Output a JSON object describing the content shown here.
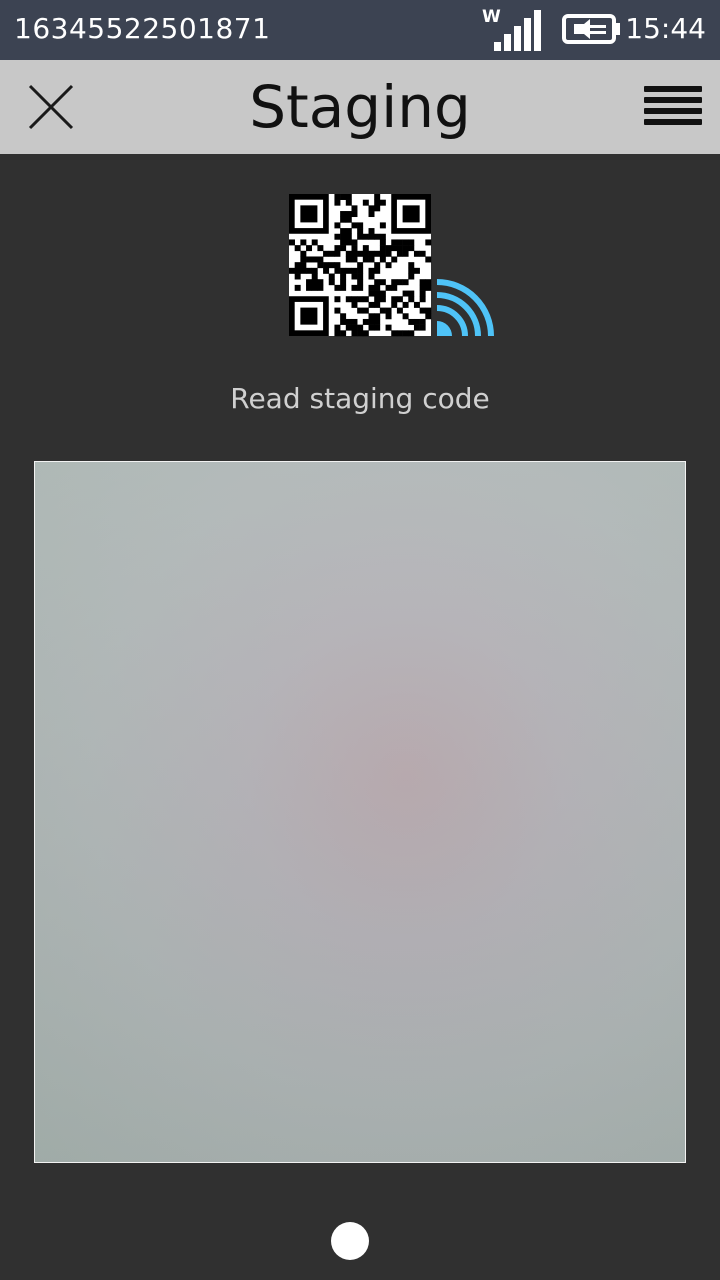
{
  "status_bar": {
    "device_id": "16345522501871",
    "network_label": "W",
    "time": "15:44",
    "signal_icon": "signal-bars-icon",
    "battery_icon": "battery-charging-icon"
  },
  "title_bar": {
    "title": "Staging",
    "close_icon": "close-icon",
    "menu_icon": "hamburger-menu-icon"
  },
  "main": {
    "header_icon": "qr-code-wireless-icon",
    "instruction": "Read staging code",
    "camera_preview": "camera-viewfinder"
  },
  "pager": {
    "dot_count": 1,
    "active_index": 0
  },
  "colors": {
    "status_bar": "#3c4352",
    "title_bar": "#c8c8c8",
    "background": "#303030",
    "wireless_accent": "#4fc3f7"
  }
}
